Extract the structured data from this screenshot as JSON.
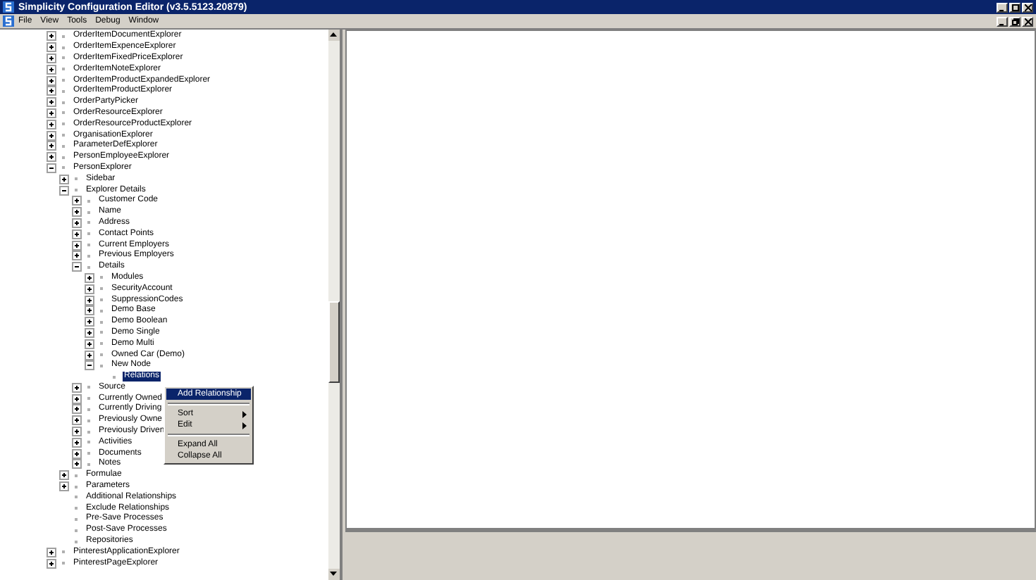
{
  "window": {
    "title": "Simplicity Configuration Editor (v3.5.5123.20879)"
  },
  "menu": [
    "File",
    "View",
    "Tools",
    "Debug",
    "Window"
  ],
  "tree": [
    {
      "label": "OrderItemDocumentExplorer",
      "expanded": false,
      "selected": false
    },
    {
      "label": "OrderItemExpenceExplorer",
      "expanded": false,
      "selected": false
    },
    {
      "label": "OrderItemFixedPriceExplorer",
      "expanded": false,
      "selected": false
    },
    {
      "label": "OrderItemNoteExplorer",
      "expanded": false,
      "selected": false
    },
    {
      "label": "OrderItemProductExpandedExplorer",
      "expanded": false,
      "selected": false
    },
    {
      "label": "OrderItemProductExplorer",
      "expanded": false,
      "selected": false
    },
    {
      "label": "OrderPartyPicker",
      "expanded": false,
      "selected": false
    },
    {
      "label": "OrderResourceExplorer",
      "expanded": false,
      "selected": false
    },
    {
      "label": "OrderResourceProductExplorer",
      "expanded": false,
      "selected": false
    },
    {
      "label": "OrganisationExplorer",
      "expanded": false,
      "selected": false
    },
    {
      "label": "ParameterDefExplorer",
      "expanded": false,
      "selected": false
    },
    {
      "label": "PersonEmployeeExplorer",
      "expanded": false,
      "selected": false
    },
    {
      "label": "PersonExplorer",
      "expanded": true,
      "selected": false,
      "children": [
        {
          "label": "Sidebar",
          "expanded": false,
          "selected": false
        },
        {
          "label": "Explorer Details",
          "expanded": true,
          "selected": false,
          "children": [
            {
              "label": "Customer Code",
              "expanded": false,
              "selected": false
            },
            {
              "label": "Name",
              "expanded": false,
              "selected": false
            },
            {
              "label": "Address",
              "expanded": false,
              "selected": false
            },
            {
              "label": "Contact Points",
              "expanded": false,
              "selected": false
            },
            {
              "label": "Current Employers",
              "expanded": false,
              "selected": false
            },
            {
              "label": "Previous Employers",
              "expanded": false,
              "selected": false
            },
            {
              "label": "Details",
              "expanded": true,
              "selected": false,
              "children": [
                {
                  "label": "Modules",
                  "expanded": false,
                  "selected": false
                },
                {
                  "label": "SecurityAccount",
                  "expanded": false,
                  "selected": false
                },
                {
                  "label": "SuppressionCodes",
                  "expanded": false,
                  "selected": false
                },
                {
                  "label": "Demo Base",
                  "expanded": false,
                  "selected": false
                },
                {
                  "label": "Demo Boolean",
                  "expanded": false,
                  "selected": false
                },
                {
                  "label": "Demo Single",
                  "expanded": false,
                  "selected": false
                },
                {
                  "label": "Demo Multi",
                  "expanded": false,
                  "selected": false
                },
                {
                  "label": "Owned Car (Demo)",
                  "expanded": false,
                  "selected": false
                },
                {
                  "label": "New Node",
                  "expanded": true,
                  "selected": false,
                  "children": [
                    {
                      "label": "Relations",
                      "selected": true
                    }
                  ]
                }
              ]
            },
            {
              "label": "Source",
              "expanded": false,
              "selected": false
            },
            {
              "label": "Currently Owned",
              "expanded": false,
              "selected": false
            },
            {
              "label": "Currently Driving",
              "expanded": false,
              "selected": false
            },
            {
              "label": "Previously Owne",
              "expanded": false,
              "selected": false
            },
            {
              "label": "Previously Driven",
              "expanded": false,
              "selected": false
            },
            {
              "label": "Activities",
              "expanded": false,
              "selected": false
            },
            {
              "label": "Documents",
              "expanded": false,
              "selected": false
            },
            {
              "label": "Notes",
              "expanded": false,
              "selected": false
            }
          ]
        },
        {
          "label": "Formulae",
          "expanded": false,
          "selected": false
        },
        {
          "label": "Parameters",
          "expanded": false,
          "selected": false
        },
        {
          "label": "Additional Relationships",
          "selected": false
        },
        {
          "label": "Exclude Relationships",
          "selected": false
        },
        {
          "label": "Pre-Save Processes",
          "selected": false
        },
        {
          "label": "Post-Save Processes",
          "selected": false
        },
        {
          "label": "Repositories",
          "selected": false
        }
      ]
    },
    {
      "label": "PinterestApplicationExplorer",
      "expanded": false,
      "selected": false
    },
    {
      "label": "PinterestPageExplorer",
      "expanded": false,
      "selected": false
    }
  ],
  "context_menu": [
    {
      "kind": "item",
      "label": "Add Relationship",
      "selected": true
    },
    {
      "kind": "separator"
    },
    {
      "kind": "submenu",
      "label": "Sort",
      "selected": false
    },
    {
      "kind": "submenu",
      "label": "Edit",
      "selected": false
    },
    {
      "kind": "separator"
    },
    {
      "kind": "item",
      "label": "Expand All",
      "selected": false
    },
    {
      "kind": "item",
      "label": "Collapse All",
      "selected": false
    }
  ]
}
